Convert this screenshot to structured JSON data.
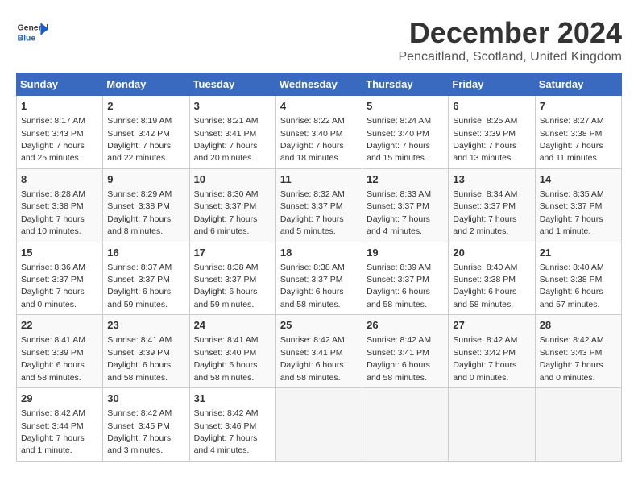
{
  "logo": {
    "general": "General",
    "blue": "Blue"
  },
  "title": "December 2024",
  "location": "Pencaitland, Scotland, United Kingdom",
  "weekdays": [
    "Sunday",
    "Monday",
    "Tuesday",
    "Wednesday",
    "Thursday",
    "Friday",
    "Saturday"
  ],
  "weeks": [
    [
      {
        "day": "1",
        "sunrise": "8:17 AM",
        "sunset": "3:43 PM",
        "daylight": "7 hours and 25 minutes."
      },
      {
        "day": "2",
        "sunrise": "8:19 AM",
        "sunset": "3:42 PM",
        "daylight": "7 hours and 22 minutes."
      },
      {
        "day": "3",
        "sunrise": "8:21 AM",
        "sunset": "3:41 PM",
        "daylight": "7 hours and 20 minutes."
      },
      {
        "day": "4",
        "sunrise": "8:22 AM",
        "sunset": "3:40 PM",
        "daylight": "7 hours and 18 minutes."
      },
      {
        "day": "5",
        "sunrise": "8:24 AM",
        "sunset": "3:40 PM",
        "daylight": "7 hours and 15 minutes."
      },
      {
        "day": "6",
        "sunrise": "8:25 AM",
        "sunset": "3:39 PM",
        "daylight": "7 hours and 13 minutes."
      },
      {
        "day": "7",
        "sunrise": "8:27 AM",
        "sunset": "3:38 PM",
        "daylight": "7 hours and 11 minutes."
      }
    ],
    [
      {
        "day": "8",
        "sunrise": "8:28 AM",
        "sunset": "3:38 PM",
        "daylight": "7 hours and 10 minutes."
      },
      {
        "day": "9",
        "sunrise": "8:29 AM",
        "sunset": "3:38 PM",
        "daylight": "7 hours and 8 minutes."
      },
      {
        "day": "10",
        "sunrise": "8:30 AM",
        "sunset": "3:37 PM",
        "daylight": "7 hours and 6 minutes."
      },
      {
        "day": "11",
        "sunrise": "8:32 AM",
        "sunset": "3:37 PM",
        "daylight": "7 hours and 5 minutes."
      },
      {
        "day": "12",
        "sunrise": "8:33 AM",
        "sunset": "3:37 PM",
        "daylight": "7 hours and 4 minutes."
      },
      {
        "day": "13",
        "sunrise": "8:34 AM",
        "sunset": "3:37 PM",
        "daylight": "7 hours and 2 minutes."
      },
      {
        "day": "14",
        "sunrise": "8:35 AM",
        "sunset": "3:37 PM",
        "daylight": "7 hours and 1 minute."
      }
    ],
    [
      {
        "day": "15",
        "sunrise": "8:36 AM",
        "sunset": "3:37 PM",
        "daylight": "7 hours and 0 minutes."
      },
      {
        "day": "16",
        "sunrise": "8:37 AM",
        "sunset": "3:37 PM",
        "daylight": "6 hours and 59 minutes."
      },
      {
        "day": "17",
        "sunrise": "8:38 AM",
        "sunset": "3:37 PM",
        "daylight": "6 hours and 59 minutes."
      },
      {
        "day": "18",
        "sunrise": "8:38 AM",
        "sunset": "3:37 PM",
        "daylight": "6 hours and 58 minutes."
      },
      {
        "day": "19",
        "sunrise": "8:39 AM",
        "sunset": "3:37 PM",
        "daylight": "6 hours and 58 minutes."
      },
      {
        "day": "20",
        "sunrise": "8:40 AM",
        "sunset": "3:38 PM",
        "daylight": "6 hours and 58 minutes."
      },
      {
        "day": "21",
        "sunrise": "8:40 AM",
        "sunset": "3:38 PM",
        "daylight": "6 hours and 57 minutes."
      }
    ],
    [
      {
        "day": "22",
        "sunrise": "8:41 AM",
        "sunset": "3:39 PM",
        "daylight": "6 hours and 58 minutes."
      },
      {
        "day": "23",
        "sunrise": "8:41 AM",
        "sunset": "3:39 PM",
        "daylight": "6 hours and 58 minutes."
      },
      {
        "day": "24",
        "sunrise": "8:41 AM",
        "sunset": "3:40 PM",
        "daylight": "6 hours and 58 minutes."
      },
      {
        "day": "25",
        "sunrise": "8:42 AM",
        "sunset": "3:41 PM",
        "daylight": "6 hours and 58 minutes."
      },
      {
        "day": "26",
        "sunrise": "8:42 AM",
        "sunset": "3:41 PM",
        "daylight": "6 hours and 58 minutes."
      },
      {
        "day": "27",
        "sunrise": "8:42 AM",
        "sunset": "3:42 PM",
        "daylight": "7 hours and 0 minutes."
      },
      {
        "day": "28",
        "sunrise": "8:42 AM",
        "sunset": "3:43 PM",
        "daylight": "7 hours and 0 minutes."
      }
    ],
    [
      {
        "day": "29",
        "sunrise": "8:42 AM",
        "sunset": "3:44 PM",
        "daylight": "7 hours and 1 minute."
      },
      {
        "day": "30",
        "sunrise": "8:42 AM",
        "sunset": "3:45 PM",
        "daylight": "7 hours and 3 minutes."
      },
      {
        "day": "31",
        "sunrise": "8:42 AM",
        "sunset": "3:46 PM",
        "daylight": "7 hours and 4 minutes."
      },
      null,
      null,
      null,
      null
    ]
  ]
}
